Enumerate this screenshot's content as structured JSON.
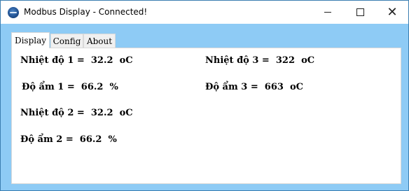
{
  "window": {
    "title": "Modbus Display - Connected!",
    "minimize_symbol": "",
    "maximize_symbol": "",
    "close_symbol": "✕"
  },
  "tabs": [
    {
      "label": "Display",
      "selected": true
    },
    {
      "label": "Config",
      "selected": false
    },
    {
      "label": "About",
      "selected": false
    }
  ],
  "readings": {
    "temp1": "Nhiệt độ 1 =  32.2  oC",
    "hum1": "Độ ẩm 1 =  66.2  %",
    "temp2": "Nhiệt độ 2 =  32.2  oC",
    "hum2": "Độ ẩm 2 =  66.2  %",
    "temp3": "Nhiệt độ 3 =  322  oC",
    "hum3": "Độ ẩm 3 =  663  oC"
  },
  "colors": {
    "window_bg": "#8ecbf5",
    "panel_bg": "#ffffff",
    "titlebar_bg": "#ffffff"
  },
  "icons": {
    "app": "modbus-app-icon"
  }
}
